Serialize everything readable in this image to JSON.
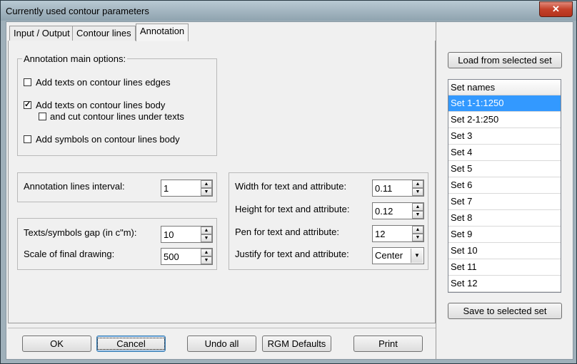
{
  "window": {
    "title": "Currently used contour parameters",
    "close_glyph": "✕"
  },
  "tabs": [
    {
      "label": "Input / Output"
    },
    {
      "label": "Contour lines"
    },
    {
      "label": "Annotation"
    }
  ],
  "annotation_main": {
    "legend": "Annotation main options:",
    "edge_texts": {
      "label": "Add texts on contour lines edges",
      "checked": false
    },
    "body_texts": {
      "label": "Add texts on contour lines body",
      "checked": true
    },
    "cut_lines": {
      "label": "and cut contour lines under texts",
      "checked": false
    },
    "symbols": {
      "label": "Add symbols on contour lines body",
      "checked": false
    }
  },
  "interval": {
    "label": "Annotation lines interval:",
    "value": "1"
  },
  "gap": {
    "label": "Texts/symbols gap (in c\"m):",
    "value": "10"
  },
  "scale": {
    "label": "Scale of final drawing:",
    "value": "500"
  },
  "text_attr": {
    "width": {
      "label": "Width for text and attribute:",
      "value": "0.11"
    },
    "height": {
      "label": "Height for text and attribute:",
      "value": "0.12"
    },
    "pen": {
      "label": "Pen for text and attribute:",
      "value": "12"
    },
    "justify": {
      "label": "Justify for text and attribute:",
      "value": "Center"
    }
  },
  "spin_up_glyph": "▲",
  "spin_down_glyph": "▼",
  "select_arrow_glyph": "▼",
  "sets": {
    "load_button": "Load from selected set",
    "header": "Set names",
    "items": [
      "Set 1-1:1250",
      "Set 2-1:250",
      "Set 3",
      "Set 4",
      "Set 5",
      "Set 6",
      "Set 7",
      "Set 8",
      "Set 9",
      "Set 10",
      "Set 11",
      "Set 12"
    ],
    "selected": "Set 1-1:1250",
    "save_button": "Save to selected set"
  },
  "buttons": {
    "ok": "OK",
    "cancel": "Cancel",
    "undo": "Undo all",
    "defaults": "RGM Defaults",
    "print": "Print"
  },
  "colors": {
    "selection": "#3399ff",
    "close": "#c4412a"
  }
}
